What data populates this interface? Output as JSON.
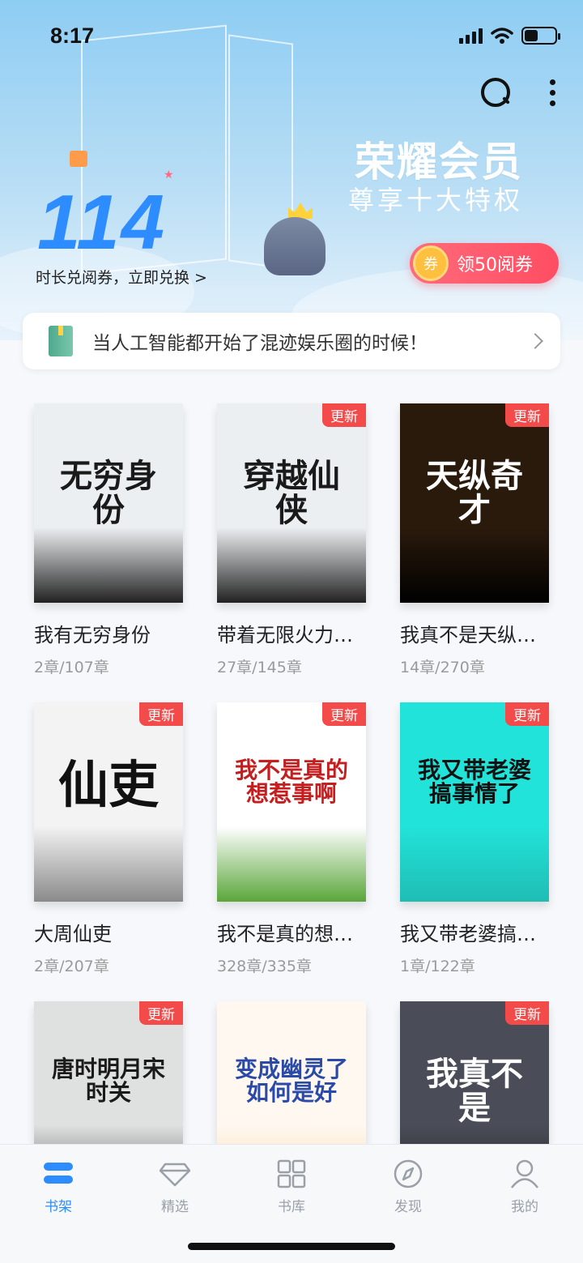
{
  "status_bar": {
    "time": "8:17"
  },
  "banner": {
    "vip_title": "荣耀会员",
    "vip_subtitle": "尊享十大特权",
    "coupon_button_label": "领50阅券",
    "coupon_coin_text": "券",
    "points_value": "114",
    "points_text": "时长兑阅券，立即兑换 >"
  },
  "notice": {
    "text": "当人工智能都开始了混迹娱乐圈的时候！"
  },
  "books": [
    {
      "title": "我有无穷身份",
      "progress": "2章/107章",
      "badge": "",
      "cover_art": "无穷身份",
      "cover_bg": "#eceff1",
      "cover_fg": "#1a1a1a",
      "ink": "#222"
    },
    {
      "title": "带着无限火力…",
      "progress": "27章/145章",
      "badge": "更新",
      "cover_art": "穿越仙侠",
      "cover_bg": "#eceff1",
      "cover_fg": "#1a1a1a",
      "ink": "#222"
    },
    {
      "title": "我真不是天纵…",
      "progress": "14章/270章",
      "badge": "更新",
      "cover_art": "天纵奇才",
      "cover_bg": "#2a1a0c",
      "cover_fg": "#ffffff",
      "ink": "#000"
    },
    {
      "title": "大周仙吏",
      "progress": "2章/207章",
      "badge": "更新",
      "cover_art": "仙吏",
      "cover_bg": "#f3f3f3",
      "cover_fg": "#111111",
      "ink": "#8a8a8a"
    },
    {
      "title": "我不是真的想…",
      "progress": "328章/335章",
      "badge": "更新",
      "cover_art": "我不是真的想惹事啊",
      "cover_bg": "#ffffff",
      "cover_fg": "#c41e1e",
      "ink": "#5aa63a"
    },
    {
      "title": "我又带老婆搞…",
      "progress": "1章/122章",
      "badge": "更新",
      "cover_art": "我又带老婆搞事情了",
      "cover_bg": "#22e3d9",
      "cover_fg": "#111111",
      "ink": "#1fbdb4"
    },
    {
      "title": "",
      "progress": "",
      "badge": "更新",
      "cover_art": "唐时明月宋时关",
      "cover_bg": "#dfe1e0",
      "cover_fg": "#1a1a1a",
      "ink": "#555"
    },
    {
      "title": "",
      "progress": "",
      "badge": "",
      "cover_art": "变成幽灵了如何是好",
      "cover_bg": "#fff8f0",
      "cover_fg": "#2a4aa8",
      "ink": "#f6d8a8"
    },
    {
      "title": "",
      "progress": "",
      "badge": "更新",
      "cover_art": "我真不是",
      "cover_bg": "#4a4d58",
      "cover_fg": "#ffffff",
      "ink": "#222"
    }
  ],
  "bottom_nav": [
    {
      "label": "书架",
      "icon": "bookshelf-icon",
      "active": true
    },
    {
      "label": "精选",
      "icon": "diamond-icon",
      "active": false
    },
    {
      "label": "书库",
      "icon": "grid-icon",
      "active": false
    },
    {
      "label": "发现",
      "icon": "compass-icon",
      "active": false
    },
    {
      "label": "我的",
      "icon": "profile-icon",
      "active": false
    }
  ],
  "colors": {
    "accent": "#2d8cff",
    "badge": "#f34a4a",
    "coupon": "#ff4d63"
  }
}
